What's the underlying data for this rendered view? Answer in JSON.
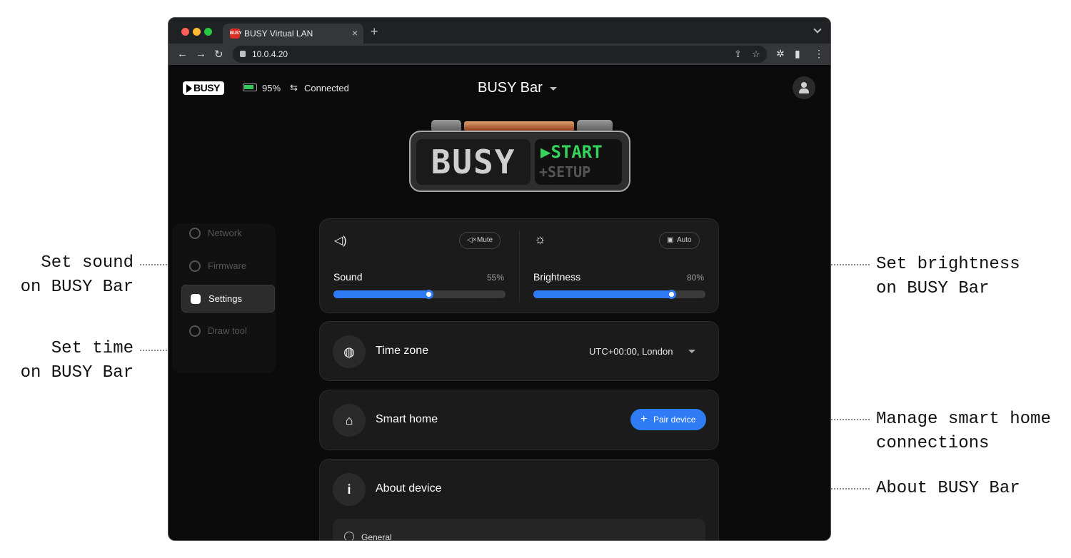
{
  "browser": {
    "tab_title": "BUSY Virtual LAN",
    "favicon_text": "BUSY",
    "url": "10.0.4.20",
    "tab_close_icon": "×",
    "new_tab_icon": "+"
  },
  "header": {
    "logo": "BUSY",
    "battery": "95%",
    "connection": "Connected",
    "device_name": "BUSY Bar"
  },
  "device_display": {
    "left": "BUSY",
    "right_top": "▶START",
    "right_bottom": "+SETUP"
  },
  "sidebar": {
    "items": [
      {
        "label": "Network",
        "icon": "network-icon"
      },
      {
        "label": "Firmware",
        "icon": "chip-icon"
      },
      {
        "label": "Settings",
        "icon": "settings-icon",
        "active": true
      },
      {
        "label": "Draw tool",
        "icon": "palette-icon"
      }
    ]
  },
  "sound": {
    "label": "Sound",
    "value": "55%",
    "fraction": 0.55,
    "mute_label": "Mute"
  },
  "brightness": {
    "label": "Brightness",
    "value": "80%",
    "fraction": 0.8,
    "auto_label": "Auto"
  },
  "timezone": {
    "label": "Time zone",
    "value": "UTC+00:00, London"
  },
  "smart_home": {
    "label": "Smart home",
    "button": "Pair device"
  },
  "about": {
    "label": "About device",
    "section": "General"
  },
  "callouts": {
    "sound": [
      "Set sound",
      "on BUSY Bar"
    ],
    "time": [
      "Set time",
      "on BUSY Bar"
    ],
    "brightness": [
      "Set brightness",
      "on BUSY Bar"
    ],
    "smart_home": [
      "Manage smart home",
      "connections"
    ],
    "about": [
      "About BUSY Bar"
    ]
  },
  "colors": {
    "accent": "#2f7bf5",
    "battery": "#34c759",
    "display_green": "#36d45a",
    "window_bg": "#0b0b0b",
    "card_bg": "#1b1b1b"
  }
}
